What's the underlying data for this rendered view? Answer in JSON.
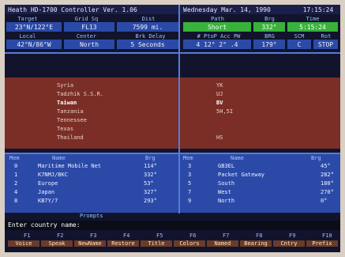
{
  "title": {
    "app": "Heath HD-1700 Controller  Ver. 1.06",
    "date": "Wednesday  Mar. 14, 1990",
    "time": "17:15:24"
  },
  "labels": {
    "target": "Target",
    "grid": "Grid Sq",
    "dist": "Dist",
    "path": "Path",
    "brg": "Brg",
    "time": "Time",
    "local": "Local",
    "center": "Center",
    "brk_delay": "Brk Delay",
    "path_cols": "# PtoP Acc PW",
    "brg2": "BRG",
    "scm": "SCM",
    "rot": "Rot"
  },
  "values": {
    "target": "23°N/122°E",
    "grid": "FL13",
    "dist": "7599 mi.",
    "path": "Short",
    "brg": "332°",
    "time": "5:15:24",
    "local": "42°N/86°W",
    "center": "North",
    "brk_delay": "5 Seconds",
    "path_params": "4  12°  2°  .4",
    "brg2": "179°",
    "scm": "C",
    "rot": "STOP"
  },
  "countries": [
    {
      "name": "Syria",
      "code": "YK",
      "selected": false
    },
    {
      "name": "Tadzhik S.S.R.",
      "code": "UJ",
      "selected": false
    },
    {
      "name": "Taiwan",
      "code": "BV",
      "selected": true
    },
    {
      "name": "Tanzania",
      "code": "5H,5I",
      "selected": false
    },
    {
      "name": "Tennessee",
      "code": "",
      "selected": false
    },
    {
      "name": "Texas",
      "code": "",
      "selected": false
    },
    {
      "name": "Thailand",
      "code": "HS",
      "selected": false
    }
  ],
  "list": {
    "left_headers": [
      "Mem",
      "Name",
      "Brg"
    ],
    "right_headers": [
      "Mem",
      "Name",
      "Brg"
    ],
    "left": [
      {
        "mem": "0",
        "name": "Maritime Mobile Net",
        "brg": "114°"
      },
      {
        "mem": "1",
        "name": "K7NMJ/BKC",
        "brg": "332°"
      },
      {
        "mem": "2",
        "name": "Europe",
        "brg": "53°"
      },
      {
        "mem": "4",
        "name": "Japan",
        "brg": "327°"
      },
      {
        "mem": "8",
        "name": "KB7Y/7",
        "brg": "293°"
      }
    ],
    "right": [
      {
        "mem": "3",
        "name": "GB3EL",
        "brg": "45°"
      },
      {
        "mem": "3",
        "name": "Packet Gateway",
        "brg": "282°"
      },
      {
        "mem": "5",
        "name": "South",
        "brg": "180°"
      },
      {
        "mem": "7",
        "name": "West",
        "brg": "270°"
      },
      {
        "mem": "9",
        "name": "North",
        "brg": "0°"
      }
    ]
  },
  "prompt": {
    "label": "Prompts",
    "text": "Enter country name:"
  },
  "fkeys": [
    {
      "key": "F1",
      "label": "Voice"
    },
    {
      "key": "F2",
      "label": "Speak"
    },
    {
      "key": "F3",
      "label": "NewName"
    },
    {
      "key": "F4",
      "label": "Restore"
    },
    {
      "key": "F5",
      "label": "Title"
    },
    {
      "key": "F6",
      "label": "Colors"
    },
    {
      "key": "F7",
      "label": "Named"
    },
    {
      "key": "F8",
      "label": "Bearing"
    },
    {
      "key": "F9",
      "label": "Cntry"
    },
    {
      "key": "F10",
      "label": "Prefix"
    }
  ]
}
